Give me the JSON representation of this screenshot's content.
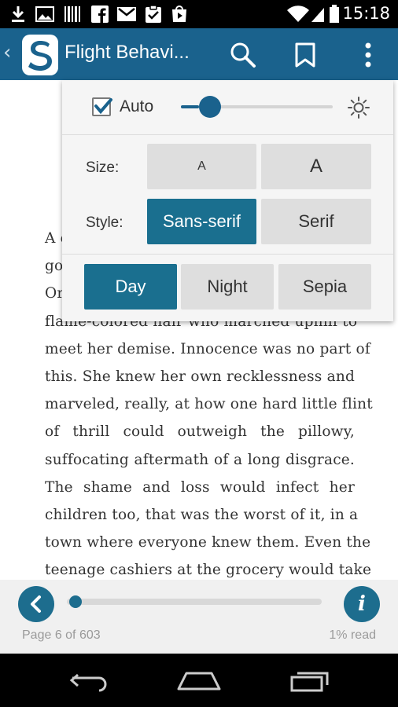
{
  "status_bar": {
    "time": "15:18",
    "icons": [
      "download-icon",
      "image-icon",
      "barcode-icon",
      "facebook-icon",
      "gmail-icon",
      "clipboard-check-icon",
      "play-store-icon",
      "wifi-icon",
      "signal-icon",
      "battery-icon"
    ]
  },
  "app_bar": {
    "title": "Flight Behavi...",
    "back_glyph": "‹",
    "logo_letter": "S",
    "actions": [
      "search-icon",
      "bookmark-icon",
      "overflow-menu-icon"
    ]
  },
  "book": {
    "lines": [
      "A c",
      "go",
      "Or",
      "flame-colored hair who marched uphill to",
      "meet her demise. Innocence was no part of",
      "this. She knew her own recklessness and",
      "marveled, really, at how one hard little flint",
      "of thrill could outweigh the pillowy,",
      "suffocating aftermath of a long disgrace.",
      "The shame and loss would infect her",
      "children too, that was the worst of it, in a",
      "town where everyone knew them. Even the",
      "teenage cashiers at the grocery would take"
    ]
  },
  "settings": {
    "auto_label": "Auto",
    "auto_checked": true,
    "brightness_fraction": 0.12,
    "size_label": "Size:",
    "size_options": [
      "A",
      "A"
    ],
    "style_label": "Style:",
    "style_options": [
      "Sans-serif",
      "Serif"
    ],
    "style_selected": "Sans-serif",
    "theme_options": [
      "Day",
      "Night",
      "Sepia"
    ],
    "theme_selected": "Day"
  },
  "bottom_bar": {
    "page_text": "Page 6 of 603",
    "read_text": "1% read",
    "info_glyph": "i",
    "progress_fraction": 0.01
  },
  "colors": {
    "brand": "#1a628d",
    "selected_button": "#1a6f8f",
    "unselected_button": "#dedede"
  }
}
